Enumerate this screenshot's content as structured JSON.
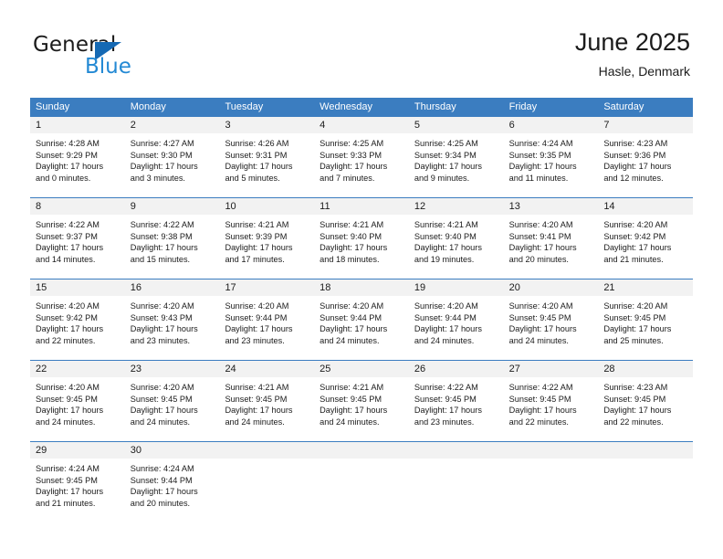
{
  "brand": {
    "name_part1": "General",
    "name_part2": "Blue",
    "triangle_color": "#1569b4",
    "blue_color": "#2389d4"
  },
  "header": {
    "title": "June 2025",
    "subtitle": "Hasle, Denmark"
  },
  "theme": {
    "header_row_bg": "#3b7dc0",
    "day_band_bg": "#f2f2f2",
    "text_color": "#1b1b1b",
    "cell_bg": "#ffffff"
  },
  "calendar": {
    "weekday_headers": [
      "Sunday",
      "Monday",
      "Tuesday",
      "Wednesday",
      "Thursday",
      "Friday",
      "Saturday"
    ],
    "weeks": [
      [
        {
          "day": "1",
          "sunrise": "Sunrise: 4:28 AM",
          "sunset": "Sunset: 9:29 PM",
          "daylight_line1": "Daylight: 17 hours",
          "daylight_line2": "and 0 minutes."
        },
        {
          "day": "2",
          "sunrise": "Sunrise: 4:27 AM",
          "sunset": "Sunset: 9:30 PM",
          "daylight_line1": "Daylight: 17 hours",
          "daylight_line2": "and 3 minutes."
        },
        {
          "day": "3",
          "sunrise": "Sunrise: 4:26 AM",
          "sunset": "Sunset: 9:31 PM",
          "daylight_line1": "Daylight: 17 hours",
          "daylight_line2": "and 5 minutes."
        },
        {
          "day": "4",
          "sunrise": "Sunrise: 4:25 AM",
          "sunset": "Sunset: 9:33 PM",
          "daylight_line1": "Daylight: 17 hours",
          "daylight_line2": "and 7 minutes."
        },
        {
          "day": "5",
          "sunrise": "Sunrise: 4:25 AM",
          "sunset": "Sunset: 9:34 PM",
          "daylight_line1": "Daylight: 17 hours",
          "daylight_line2": "and 9 minutes."
        },
        {
          "day": "6",
          "sunrise": "Sunrise: 4:24 AM",
          "sunset": "Sunset: 9:35 PM",
          "daylight_line1": "Daylight: 17 hours",
          "daylight_line2": "and 11 minutes."
        },
        {
          "day": "7",
          "sunrise": "Sunrise: 4:23 AM",
          "sunset": "Sunset: 9:36 PM",
          "daylight_line1": "Daylight: 17 hours",
          "daylight_line2": "and 12 minutes."
        }
      ],
      [
        {
          "day": "8",
          "sunrise": "Sunrise: 4:22 AM",
          "sunset": "Sunset: 9:37 PM",
          "daylight_line1": "Daylight: 17 hours",
          "daylight_line2": "and 14 minutes."
        },
        {
          "day": "9",
          "sunrise": "Sunrise: 4:22 AM",
          "sunset": "Sunset: 9:38 PM",
          "daylight_line1": "Daylight: 17 hours",
          "daylight_line2": "and 15 minutes."
        },
        {
          "day": "10",
          "sunrise": "Sunrise: 4:21 AM",
          "sunset": "Sunset: 9:39 PM",
          "daylight_line1": "Daylight: 17 hours",
          "daylight_line2": "and 17 minutes."
        },
        {
          "day": "11",
          "sunrise": "Sunrise: 4:21 AM",
          "sunset": "Sunset: 9:40 PM",
          "daylight_line1": "Daylight: 17 hours",
          "daylight_line2": "and 18 minutes."
        },
        {
          "day": "12",
          "sunrise": "Sunrise: 4:21 AM",
          "sunset": "Sunset: 9:40 PM",
          "daylight_line1": "Daylight: 17 hours",
          "daylight_line2": "and 19 minutes."
        },
        {
          "day": "13",
          "sunrise": "Sunrise: 4:20 AM",
          "sunset": "Sunset: 9:41 PM",
          "daylight_line1": "Daylight: 17 hours",
          "daylight_line2": "and 20 minutes."
        },
        {
          "day": "14",
          "sunrise": "Sunrise: 4:20 AM",
          "sunset": "Sunset: 9:42 PM",
          "daylight_line1": "Daylight: 17 hours",
          "daylight_line2": "and 21 minutes."
        }
      ],
      [
        {
          "day": "15",
          "sunrise": "Sunrise: 4:20 AM",
          "sunset": "Sunset: 9:42 PM",
          "daylight_line1": "Daylight: 17 hours",
          "daylight_line2": "and 22 minutes."
        },
        {
          "day": "16",
          "sunrise": "Sunrise: 4:20 AM",
          "sunset": "Sunset: 9:43 PM",
          "daylight_line1": "Daylight: 17 hours",
          "daylight_line2": "and 23 minutes."
        },
        {
          "day": "17",
          "sunrise": "Sunrise: 4:20 AM",
          "sunset": "Sunset: 9:44 PM",
          "daylight_line1": "Daylight: 17 hours",
          "daylight_line2": "and 23 minutes."
        },
        {
          "day": "18",
          "sunrise": "Sunrise: 4:20 AM",
          "sunset": "Sunset: 9:44 PM",
          "daylight_line1": "Daylight: 17 hours",
          "daylight_line2": "and 24 minutes."
        },
        {
          "day": "19",
          "sunrise": "Sunrise: 4:20 AM",
          "sunset": "Sunset: 9:44 PM",
          "daylight_line1": "Daylight: 17 hours",
          "daylight_line2": "and 24 minutes."
        },
        {
          "day": "20",
          "sunrise": "Sunrise: 4:20 AM",
          "sunset": "Sunset: 9:45 PM",
          "daylight_line1": "Daylight: 17 hours",
          "daylight_line2": "and 24 minutes."
        },
        {
          "day": "21",
          "sunrise": "Sunrise: 4:20 AM",
          "sunset": "Sunset: 9:45 PM",
          "daylight_line1": "Daylight: 17 hours",
          "daylight_line2": "and 25 minutes."
        }
      ],
      [
        {
          "day": "22",
          "sunrise": "Sunrise: 4:20 AM",
          "sunset": "Sunset: 9:45 PM",
          "daylight_line1": "Daylight: 17 hours",
          "daylight_line2": "and 24 minutes."
        },
        {
          "day": "23",
          "sunrise": "Sunrise: 4:20 AM",
          "sunset": "Sunset: 9:45 PM",
          "daylight_line1": "Daylight: 17 hours",
          "daylight_line2": "and 24 minutes."
        },
        {
          "day": "24",
          "sunrise": "Sunrise: 4:21 AM",
          "sunset": "Sunset: 9:45 PM",
          "daylight_line1": "Daylight: 17 hours",
          "daylight_line2": "and 24 minutes."
        },
        {
          "day": "25",
          "sunrise": "Sunrise: 4:21 AM",
          "sunset": "Sunset: 9:45 PM",
          "daylight_line1": "Daylight: 17 hours",
          "daylight_line2": "and 24 minutes."
        },
        {
          "day": "26",
          "sunrise": "Sunrise: 4:22 AM",
          "sunset": "Sunset: 9:45 PM",
          "daylight_line1": "Daylight: 17 hours",
          "daylight_line2": "and 23 minutes."
        },
        {
          "day": "27",
          "sunrise": "Sunrise: 4:22 AM",
          "sunset": "Sunset: 9:45 PM",
          "daylight_line1": "Daylight: 17 hours",
          "daylight_line2": "and 22 minutes."
        },
        {
          "day": "28",
          "sunrise": "Sunrise: 4:23 AM",
          "sunset": "Sunset: 9:45 PM",
          "daylight_line1": "Daylight: 17 hours",
          "daylight_line2": "and 22 minutes."
        }
      ],
      [
        {
          "day": "29",
          "sunrise": "Sunrise: 4:24 AM",
          "sunset": "Sunset: 9:45 PM",
          "daylight_line1": "Daylight: 17 hours",
          "daylight_line2": "and 21 minutes."
        },
        {
          "day": "30",
          "sunrise": "Sunrise: 4:24 AM",
          "sunset": "Sunset: 9:44 PM",
          "daylight_line1": "Daylight: 17 hours",
          "daylight_line2": "and 20 minutes."
        },
        {
          "day": "",
          "sunrise": "",
          "sunset": "",
          "daylight_line1": "",
          "daylight_line2": ""
        },
        {
          "day": "",
          "sunrise": "",
          "sunset": "",
          "daylight_line1": "",
          "daylight_line2": ""
        },
        {
          "day": "",
          "sunrise": "",
          "sunset": "",
          "daylight_line1": "",
          "daylight_line2": ""
        },
        {
          "day": "",
          "sunrise": "",
          "sunset": "",
          "daylight_line1": "",
          "daylight_line2": ""
        },
        {
          "day": "",
          "sunrise": "",
          "sunset": "",
          "daylight_line1": "",
          "daylight_line2": ""
        }
      ]
    ]
  }
}
